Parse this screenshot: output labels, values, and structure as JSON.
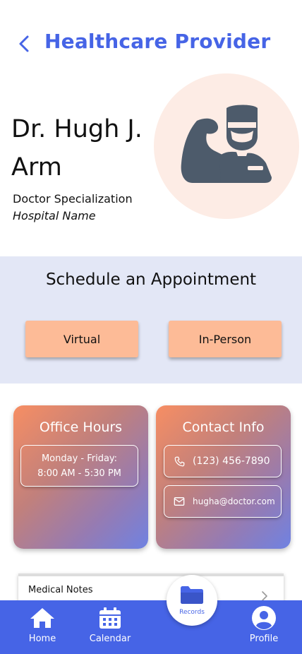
{
  "header": {
    "title": "Healthcare Provider",
    "back_icon": "chevron-left-icon"
  },
  "doctor": {
    "name": "Dr. Hugh J. Arm",
    "specialization": "Doctor Specialization",
    "hospital": "Hospital Name",
    "avatar_icon": "surgeon-flexing-arm-icon"
  },
  "schedule": {
    "title": "Schedule an Appointment",
    "virtual_label": "Virtual",
    "in_person_label": "In-Person"
  },
  "office_hours": {
    "title": "Office Hours",
    "days": "Monday - Friday:",
    "hours": "8:00 AM - 5:30 PM"
  },
  "contact": {
    "title": "Contact Info",
    "phone": "(123) 456-7890",
    "email": "hugha@doctor.com",
    "phone_icon": "phone-icon",
    "email_icon": "mail-icon"
  },
  "notes": {
    "label": "Medical Notes",
    "chevron_icon": "chevron-right-icon"
  },
  "nav": {
    "home": "Home",
    "calendar": "Calendar",
    "records": "Records",
    "profile": "Profile"
  },
  "colors": {
    "primary": "#4664e6",
    "schedule_bg": "#e3e7f6",
    "button": "#fdbb97",
    "avatar_bg": "#fdece5",
    "icon_slate": "#4d5b6b",
    "gradient_start": "#f78e63",
    "gradient_end": "#6f82e2"
  }
}
